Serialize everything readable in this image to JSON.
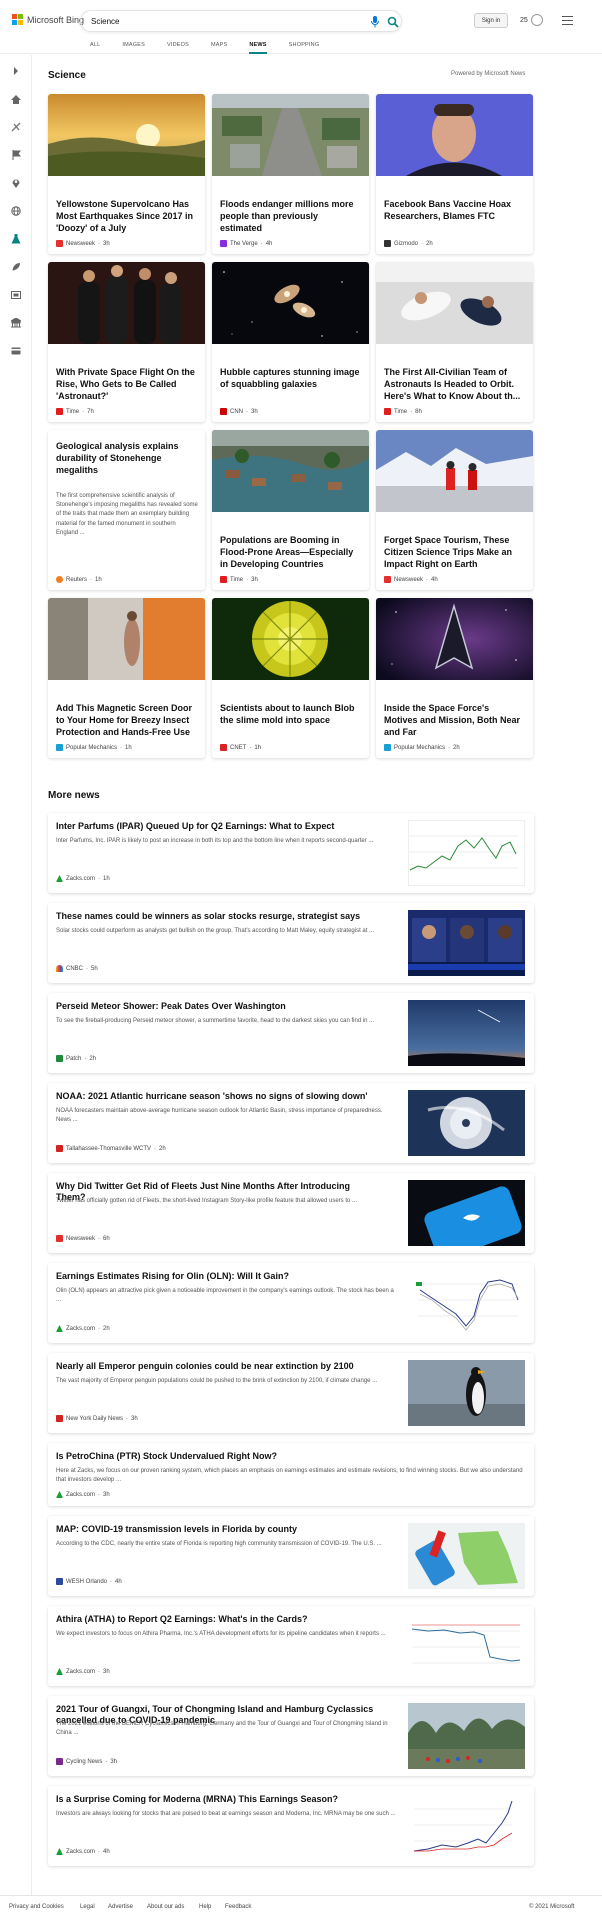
{
  "header": {
    "logo_text": "Microsoft Bing",
    "search_value": "Science",
    "signin_label": "Sign in",
    "rewards_count": "25",
    "tabs": [
      "ALL",
      "IMAGES",
      "VIDEOS",
      "MAPS",
      "NEWS",
      "SHOPPING"
    ]
  },
  "section": {
    "title": "Science",
    "powered_by": "Powered by Microsoft News"
  },
  "cards": [
    {
      "title": "Yellowstone Supervolcano Has Most Earthquakes Since 2017 in 'Doozy' of a July",
      "source": "Newsweek",
      "age": "3h",
      "icon_color": "#e62e2e"
    },
    {
      "title": "Floods endanger millions more people than previously estimated",
      "source": "The Verge",
      "age": "4h",
      "icon_color": "#8a2be2"
    },
    {
      "title": "Facebook Bans Vaccine Hoax Researchers, Blames FTC",
      "source": "Gizmodo",
      "age": "2h",
      "icon_color": "#333333"
    },
    {
      "title": "With Private Space Flight On the Rise, Who Gets to Be Called 'Astronaut?'",
      "source": "Time",
      "age": "7h",
      "icon_color": "#e31c1c"
    },
    {
      "title": "Hubble captures stunning image of squabbling galaxies",
      "source": "CNN",
      "age": "3h",
      "icon_color": "#cc0000"
    },
    {
      "title": "The First All-Civilian Team of Astronauts Is Headed to Orbit. Here's What to Know About th...",
      "source": "Time",
      "age": "8h",
      "icon_color": "#e31c1c"
    },
    {
      "title": "Geological analysis explains durability of Stonehenge megaliths",
      "abstract": "The first comprehensive scientific analysis of Stonehenge's imposing megaliths has revealed some of the traits that made them an exemplary building material for the famed monument in southern England ...",
      "source": "Reuters",
      "age": "1h",
      "icon_color": "#f47b20"
    },
    {
      "title": "Populations are Booming in Flood-Prone Areas—Especially in Developing Countries",
      "source": "Time",
      "age": "3h",
      "icon_color": "#e31c1c"
    },
    {
      "title": "Forget Space Tourism, These Citizen Science Trips Make an Impact Right on Earth",
      "source": "Newsweek",
      "age": "4h",
      "icon_color": "#e62e2e"
    },
    {
      "title": "Add This Magnetic Screen Door to Your Home for Breezy Insect Protection and Hands-Free Use",
      "source": "Popular Mechanics",
      "age": "1h",
      "icon_color": "#19a0d6"
    },
    {
      "title": "Scientists about to launch Blob the slime mold into space",
      "source": "CNET",
      "age": "1h",
      "icon_color": "#d92222"
    },
    {
      "title": "Inside the Space Force's Motives and Mission, Both Near and Far",
      "source": "Popular Mechanics",
      "age": "2h",
      "icon_color": "#19a0d6"
    }
  ],
  "more_news": {
    "title": "More news",
    "items": [
      {
        "title": "Inter Parfums (IPAR) Queued Up for Q2 Earnings: What to Expect",
        "snippet": "Inter Parfums, Inc. IPAR is likely to post an increase in both its top and the bottom line when it reports second-quarter ...",
        "source": "Zacks.com",
        "age": "1h",
        "icon_color": "#1a9e3a"
      },
      {
        "title": "These names could be winners as solar stocks resurge, strategist says",
        "snippet": "Solar stocks could outperform as analysts get bullish on the group. That's according to Matt Maley, equity strategist at ...",
        "source": "CNBC",
        "age": "5h",
        "icon_color": "#e94b3c"
      },
      {
        "title": "Perseid Meteor Shower: Peak Dates Over Washington",
        "snippet": "To see the fireball-producing Perseid meteor shower, a summertime favorite, head to the darkest skies you can find in ...",
        "source": "Patch",
        "age": "2h",
        "icon_color": "#1f8a3a"
      },
      {
        "title": "NOAA: 2021 Atlantic hurricane season 'shows no signs of slowing down'",
        "snippet": "NOAA forecasters maintain above-average hurricane season outlook for Atlantic Basin, stress importance of preparedness. News ...",
        "source": "Tallahassee-Thomasville WCTV",
        "age": "2h",
        "icon_color": "#d32222"
      },
      {
        "title": "Why Did Twitter Get Rid of Fleets Just Nine Months After Introducing Them?",
        "snippet": "Twitter has officially gotten rid of Fleets, the short-lived Instagram Story-like profile feature that allowed users to ...",
        "source": "Newsweek",
        "age": "6h",
        "icon_color": "#e62e2e"
      },
      {
        "title": "Earnings Estimates Rising for Olin (OLN): Will It Gain?",
        "snippet": "Olin (OLN) appears an attractive pick given a noticeable improvement in the company's earnings outlook. The stock has been a ...",
        "source": "Zacks.com",
        "age": "2h",
        "icon_color": "#1a9e3a"
      },
      {
        "title": "Nearly all Emperor penguin colonies could be near extinction by 2100",
        "snippet": "The vast majority of Emperor penguin populations could be pushed to the brink of extinction by 2100, if climate change ...",
        "source": "New York Daily News",
        "age": "3h",
        "icon_color": "#d32222"
      },
      {
        "title": "Is PetroChina (PTR) Stock Undervalued Right Now?",
        "snippet": "Here at Zacks, we focus on our proven ranking system, which places an emphasis on earnings estimates and estimate revisions, to find winning stocks. But we also understand that investors develop ...",
        "source": "Zacks.com",
        "age": "3h",
        "icon_color": "#1a9e3a"
      },
      {
        "title": "MAP: COVID-19 transmission levels in Florida by county",
        "snippet": "According to the CDC, nearly the entire state of Florida is reporting high community transmission of COVID-19. The U.S. ...",
        "source": "WESH Orlando",
        "age": "4h",
        "icon_color": "#2b4aa0"
      },
      {
        "title": "Athira (ATHA) to Report Q2 Earnings: What's in the Cards?",
        "snippet": "We expect investors to focus on Athira Pharma, Inc.'s ATHA development efforts for its pipeline candidates when it reports ...",
        "source": "Zacks.com",
        "age": "3h",
        "icon_color": "#1a9e3a"
      },
      {
        "title": "2021 Tour of Guangxi, Tour of Chongming Island and Hamburg Cyclassics cancelled due to COVID-19 pandemic",
        "snippet": "The 2021 editions of the BEMER Cyclassics in Hamburg, Germany and the Tour of Guangxi and Tour of Chongming Island in China ...",
        "source": "Cycling News",
        "age": "3h",
        "icon_color": "#7a2a8a"
      },
      {
        "title": "Is a Surprise Coming for Moderna (MRNA) This Earnings Season?",
        "snippet": "Investors are always looking for stocks that are poised to beat at earnings season and Moderna, Inc. MRNA may be one such ...",
        "source": "Zacks.com",
        "age": "4h",
        "icon_color": "#1a9e3a"
      }
    ]
  },
  "footer": {
    "links": [
      "Privacy and Cookies",
      "Legal",
      "Advertise",
      "About our ads",
      "Help",
      "Feedback"
    ],
    "copyright": "© 2021 Microsoft"
  }
}
